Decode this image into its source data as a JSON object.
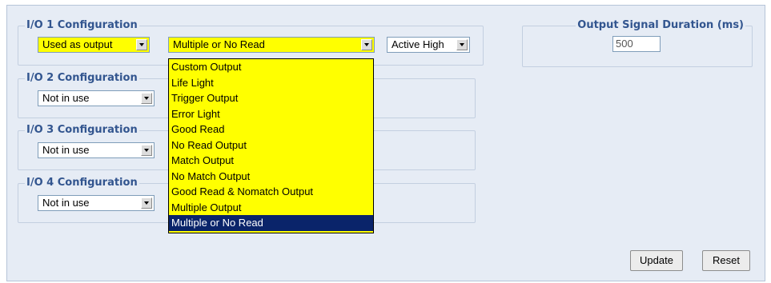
{
  "io_groups": [
    {
      "legend": "I/O 1 Configuration"
    },
    {
      "legend": "I/O 2 Configuration"
    },
    {
      "legend": "I/O 3 Configuration"
    },
    {
      "legend": "I/O 4 Configuration"
    }
  ],
  "io1": {
    "mode_value": "Used as output",
    "function_value": "Multiple or No Read",
    "polarity_value": "Active High"
  },
  "io2": {
    "mode_value": "Not in use"
  },
  "io3": {
    "mode_value": "Not in use"
  },
  "io4": {
    "mode_value": "Not in use"
  },
  "dropdown_options": [
    "Custom Output",
    "Life Light",
    "Trigger Output",
    "Error Light",
    "Good Read",
    "No Read Output",
    "Match Output",
    "No Match Output",
    "Good Read & Nomatch Output",
    "Multiple Output",
    "Multiple or No Read"
  ],
  "dropdown_selected": "Multiple or No Read",
  "output_duration": {
    "legend": "Output Signal Duration (ms)",
    "value": "500"
  },
  "buttons": {
    "update": "Update",
    "reset": "Reset"
  },
  "colors": {
    "highlight_yellow": "#ffff00",
    "legend_blue": "#32558f",
    "panel_bg": "#e6ecf5",
    "selection_navy": "#0a246a"
  }
}
